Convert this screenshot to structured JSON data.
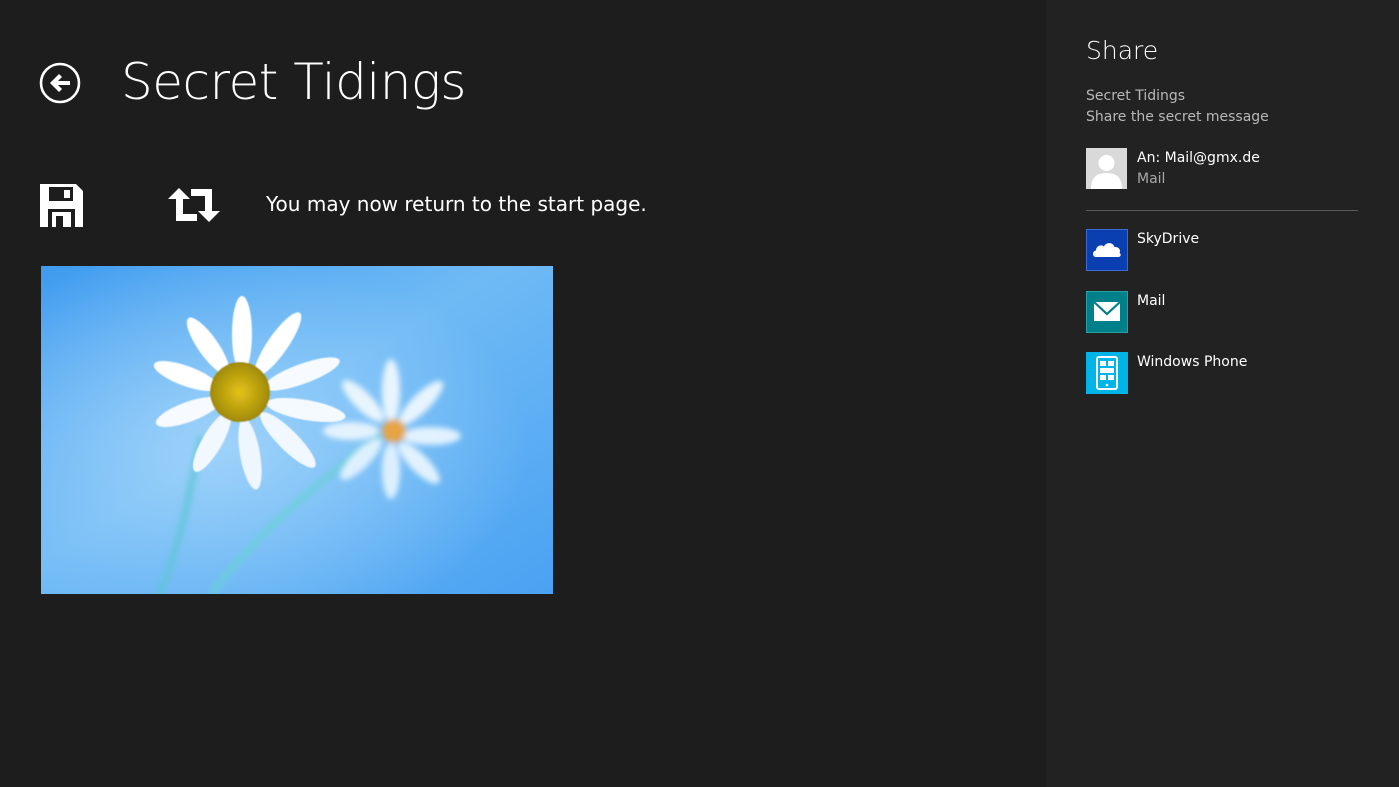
{
  "app": {
    "title": "Secret Tidings",
    "status_message": "You may now return to the start page.",
    "back_icon": "back-arrow-icon",
    "save_icon": "floppy-disk-icon",
    "refresh_icon": "refresh-icon",
    "image_description_icon": "daisy-photo"
  },
  "share": {
    "title": "Share",
    "app_name": "Secret Tidings",
    "description": "Share the secret message",
    "contact": {
      "primary": "An: Mail@gmx.de",
      "secondary": "Mail",
      "icon": "person-avatar-icon"
    },
    "targets": [
      {
        "label": "SkyDrive",
        "icon": "cloud-icon",
        "color": "#0a3fb1"
      },
      {
        "label": "Mail",
        "icon": "envelope-icon",
        "color": "#00808a"
      },
      {
        "label": "Windows Phone",
        "icon": "phone-icon",
        "color": "#00b4e8"
      }
    ]
  },
  "colors": {
    "background": "#1d1d1d",
    "pane_background": "#222222",
    "secondary_text": "#b8b8b8"
  }
}
